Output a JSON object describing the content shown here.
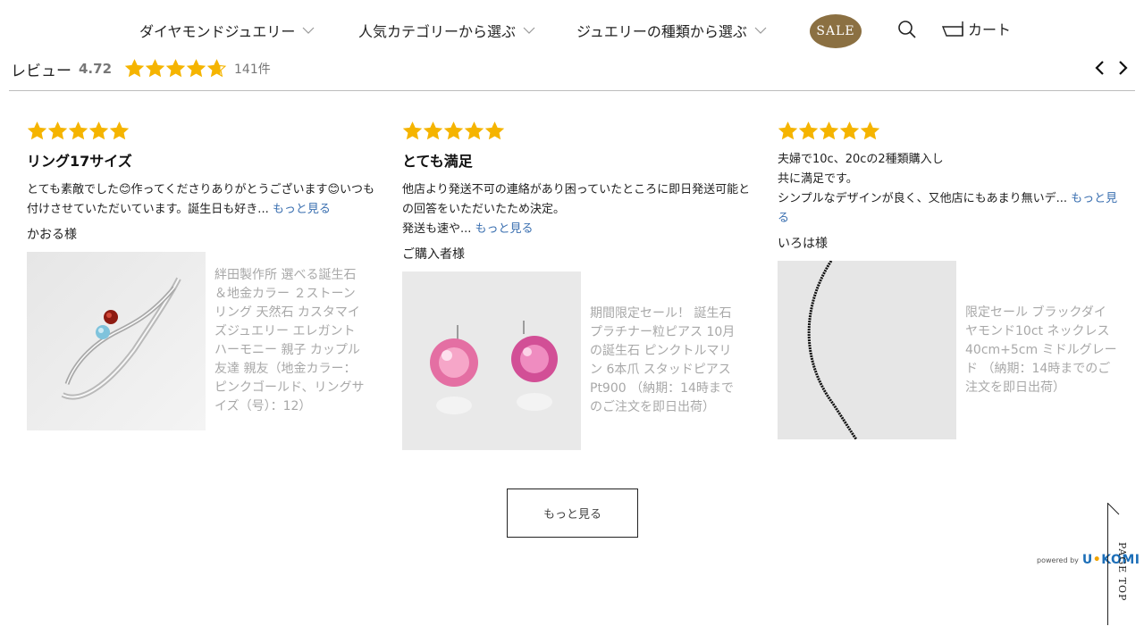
{
  "nav": {
    "items": [
      {
        "label": "ダイヤモンドジュエリー"
      },
      {
        "label": "人気カテゴリーから選ぶ"
      },
      {
        "label": "ジュエリーの種類から選ぶ"
      }
    ],
    "sale_label": "SALE",
    "cart_label": "カート"
  },
  "summary": {
    "label": "レビュー",
    "score": "4.72",
    "rating": 4.72,
    "count": "141件"
  },
  "colors": {
    "star": "#f5b400",
    "sale_bg": "#8b7042",
    "link": "#3a6fb0",
    "product_text": "#a8a8a8"
  },
  "reviews": [
    {
      "stars": 5,
      "title": "リング17サイズ",
      "body": "とても素敵でした😊作ってくださりありがとうございます😊いつも付けさせていただいています。誕生日も好き...",
      "more": "もっと見る",
      "user": "かおる様",
      "product": "絆田製作所 選べる誕生石＆地金カラー ２ストーンリング 天然石 カスタマイズジュエリー エレガントハーモニー 親子 カップル 友達 親友（地金カラー：ピンクゴールド、リングサイズ（号）：12）"
    },
    {
      "stars": 5,
      "title": "とても満足",
      "body": "他店より発送不可の連絡があり困っていたところに即日発送可能との回答をいただいたため決定。\n発送も速や...",
      "more": "もっと見る",
      "user": "ご購入者様",
      "product": "期間限定セール！ 誕生石 プラチナー粒ピアス 10月の誕生石 ピンクトルマリン 6本爪 スタッドピアス Pt900 （納期：14時までのご注文を即日出荷）"
    },
    {
      "stars": 5,
      "title": "",
      "body": "夫婦で10c、20cの2種類購入し\n共に満足です。\nシンプルなデザインが良く、又他店にもあまり無いデ...",
      "more": "もっと見る",
      "user": "いろは様",
      "product": "限定セール ブラックダイヤモンド10ct ネックレス 40cm+5cm ミドルグレード （納期：14時までのご注文を即日出荷）"
    }
  ],
  "more_button": "もっと見る",
  "powered": {
    "prefix": "powered by",
    "brand_a": "U",
    "brand_dot": "•",
    "brand_b": "KOMI"
  },
  "page_top": "PAGE TOP"
}
